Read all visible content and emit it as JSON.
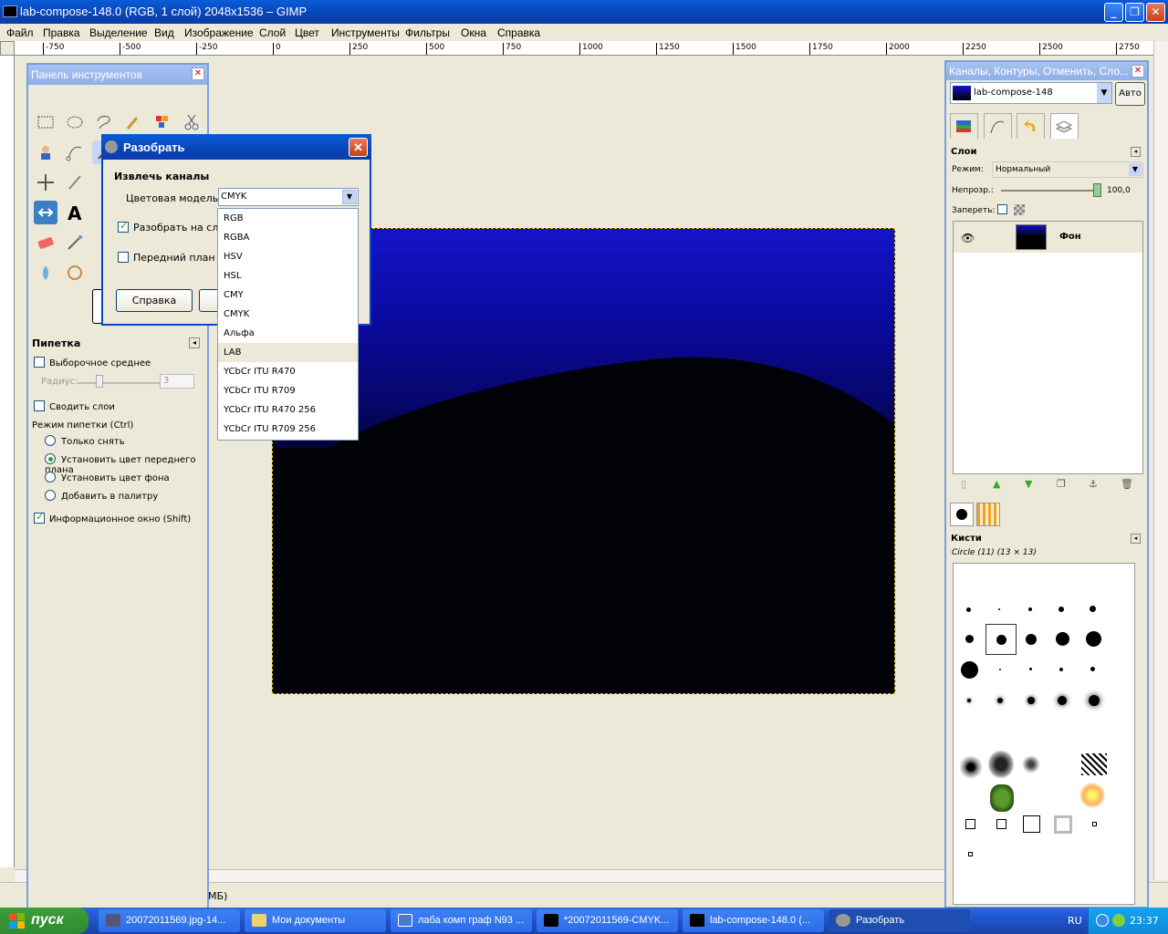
{
  "window": {
    "title": "lab-compose-148.0 (RGB, 1 слой) 2048x1536 – GIMP"
  },
  "menu": [
    "Файл",
    "Правка",
    "Выделение",
    "Вид",
    "Изображение",
    "Слой",
    "Цвет",
    "Инструменты",
    "Фильтры",
    "Окна",
    "Справка"
  ],
  "ruler": [
    "-750",
    "-500",
    "-250",
    "0",
    "250",
    "500",
    "750",
    "1000",
    "1250",
    "1500",
    "1750",
    "2000",
    "2250",
    "2500",
    "2750"
  ],
  "status": {
    "text": "МБ)"
  },
  "toolbox": {
    "title": "Панель инструментов",
    "picker": {
      "title": "Пипетка",
      "sample_average": "Выборочное среднее",
      "radius_label": "Радиус:",
      "radius_value": "3",
      "sample_merged": "Сводить слои",
      "mode_label": "Режим пипетки (Ctrl)",
      "modes": [
        "Только снять",
        "Установить цвет переднего плана",
        "Установить цвет фона",
        "Добавить в палитру"
      ],
      "selected_mode": 1,
      "info_window": "Информационное окно (Shift)"
    }
  },
  "dock": {
    "title": "Каналы, Контуры, Отменить, Сло...",
    "image_select": "lab-compose-148",
    "auto_button": "Авто",
    "layers": {
      "title": "Слои",
      "mode_label": "Режим:",
      "mode_value": "Нормальный",
      "opacity_label": "Непрозр.:",
      "opacity_value": "100,0",
      "lock_label": "Запереть:",
      "items": [
        {
          "name": "Фон",
          "visible": true
        }
      ]
    },
    "brushes": {
      "title": "Кисти",
      "current": "Circle (11) (13 × 13)"
    }
  },
  "dialog": {
    "title": "Разобрать",
    "section": "Извлечь каналы",
    "color_model_label": "Цветовая модель:",
    "color_model_value": "CMYK",
    "decompose_layers": "Разобрать на слои",
    "foreground_label": "Передний план ка",
    "help_button": "Справка"
  },
  "dropdown": {
    "options": [
      "RGB",
      "RGBA",
      "HSV",
      "HSL",
      "CMY",
      "CMYK",
      "Альфа",
      "LAB",
      "YCbCr ITU R470",
      "YCbCr ITU R709",
      "YCbCr ITU R470 256",
      "YCbCr ITU R709 256"
    ],
    "highlighted": "LAB"
  },
  "taskbar": {
    "start": "пуск",
    "tasks": [
      "20072011569.jpg-14...",
      "Мои документы",
      "лаба комп граф N93 ...",
      "*20072011569-CMYK...",
      "lab-compose-148.0 (...",
      "Разобрать"
    ],
    "lang": "RU",
    "clock": "23:37"
  }
}
